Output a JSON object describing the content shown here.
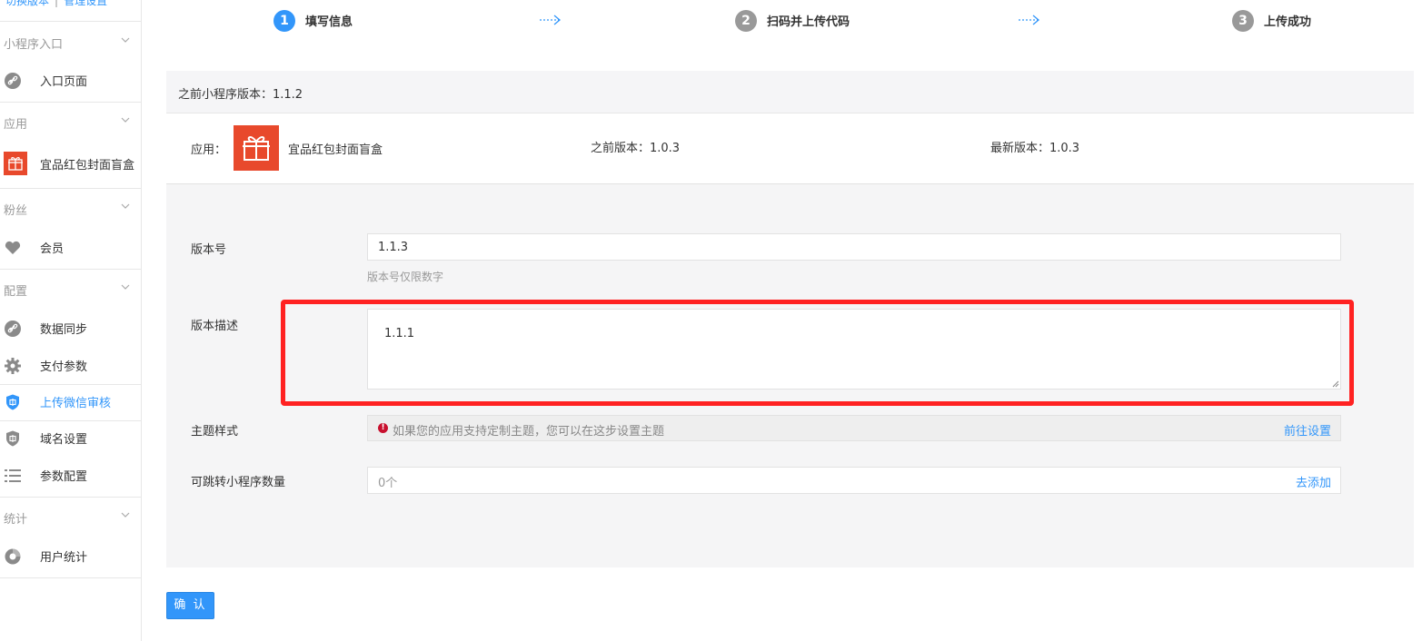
{
  "sidebar": {
    "top_links": {
      "switch_version": "切换版本",
      "separator": "|",
      "manage_settings": "管理设置"
    },
    "groups": [
      {
        "title": "小程序入口",
        "items": [
          {
            "label": "入口页面",
            "icon": "link-icon"
          }
        ]
      },
      {
        "title": "应用",
        "items": [
          {
            "label": "宜品红包封面盲盒",
            "icon": "gift-app-icon"
          }
        ]
      },
      {
        "title": "粉丝",
        "items": [
          {
            "label": "会员",
            "icon": "heart-icon"
          }
        ]
      },
      {
        "title": "配置",
        "items": [
          {
            "label": "数据同步",
            "icon": "link-icon"
          },
          {
            "label": "支付参数",
            "icon": "gear-icon"
          },
          {
            "label": "上传微信审核",
            "icon": "shield-icon",
            "active": true
          },
          {
            "label": "域名设置",
            "icon": "shield-icon"
          },
          {
            "label": "参数配置",
            "icon": "list-icon"
          }
        ]
      },
      {
        "title": "统计",
        "items": [
          {
            "label": "用户统计",
            "icon": "pie-icon"
          }
        ]
      }
    ]
  },
  "steps": [
    {
      "num": "1",
      "label": "填写信息",
      "active": true
    },
    {
      "num": "2",
      "label": "扫码并上传代码",
      "active": false
    },
    {
      "num": "3",
      "label": "上传成功",
      "active": false
    }
  ],
  "previous_miniapp_version": "之前小程序版本：1.1.2",
  "app_info": {
    "app_label": "应用：",
    "app_name": "宜品红包封面盲盒",
    "previous_version": "之前版本：1.0.3",
    "latest_version": "最新版本：1.0.3"
  },
  "form": {
    "version_label": "版本号",
    "version_value": "1.1.3",
    "version_hint": "版本号仅限数字",
    "desc_label": "版本描述",
    "desc_value": "1.1.1",
    "theme_label": "主题样式",
    "theme_notice": "如果您的应用支持定制主题，您可以在这步设置主题",
    "theme_link": "前往设置",
    "jump_label": "可跳转小程序数量",
    "jump_value": "0个",
    "jump_link": "去添加"
  },
  "confirm_label": "确 认",
  "colors": {
    "accent": "#3296fa",
    "highlight": "#ff2222",
    "app_icon": "#e8492c",
    "warn": "#c8102e"
  }
}
